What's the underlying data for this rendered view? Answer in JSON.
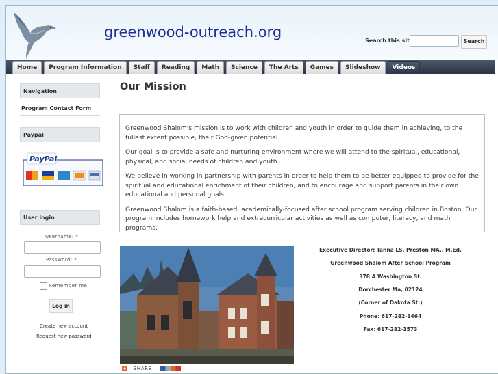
{
  "site": {
    "name": "greenwood-outreach.org"
  },
  "search": {
    "label": "Search this site:",
    "button": "Search",
    "value": ""
  },
  "tabs": [
    "Home",
    "Program Information",
    "Staff",
    "Reading",
    "Math",
    "Science",
    "The Arts",
    "Games",
    "Slideshow",
    "Videos"
  ],
  "sidebar": {
    "navigation_title": "Navigation",
    "navigation_items": [
      "Program Contact Form"
    ],
    "paypal_title": "Paypal",
    "paypal_logo_text": "PayPal",
    "user_login_title": "User login",
    "username_label": "Username: *",
    "password_label": "Password: *",
    "remember_label": "Remember me",
    "login_button": "Log in",
    "create_account": "Create new account",
    "request_password": "Request new password"
  },
  "main": {
    "title": "Our Mission",
    "paragraphs": [
      "Greenwood Shalom's mission is to work with children and youth in order to guide them in achieving, to the fullest extent possible, their God-given potential.",
      "Our goal is to provide a safe and nurturing environment where we will attend to the spiritual, educational, physical, and social needs of children and youth..",
      "We believe in working in partnership with parents in order to help them to be better equipped to provide for the spiritual and educational enrichment of their children, and to encourage and support parents in their own educational and personal goals.",
      "Greenwood Shalom is a faith-based, academically-focused after school program serving children in Boston. Our program includes  homework help and extracurricular activities as well as computer, literacy, and math programs."
    ],
    "contact": [
      "Executive Director: Tanna LS. Preston MA., M.Ed.",
      "Greenwood Shalom After School Program",
      "378 A Washington St.",
      "Dorchester Ma, 02124",
      "(Corner of Dakota St.)",
      "Phone: 617-282-1464",
      "Fax: 617-282-1573"
    ],
    "share_label": "SHARE"
  },
  "colors": {
    "nav_dark": "#2c3545",
    "site_name": "#1f2f9a",
    "page_bg": "#dfeef8"
  }
}
